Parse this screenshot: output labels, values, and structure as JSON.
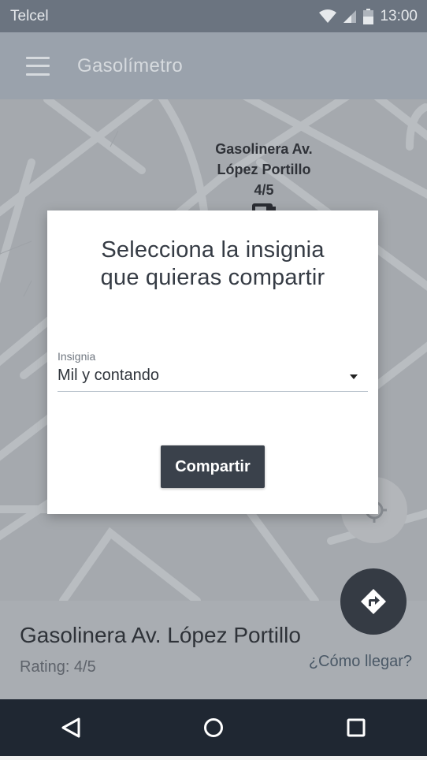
{
  "status_bar": {
    "carrier": "Telcel",
    "time": "13:00",
    "icons": [
      "wifi-icon",
      "signal-icon",
      "battery-icon"
    ]
  },
  "app_bar": {
    "title": "Gasolímetro",
    "menu_icon": "hamburger-menu-icon"
  },
  "map": {
    "marker_label_lines": [
      "Gasolinera Av.",
      "López Portillo",
      "4/5"
    ],
    "marker_icon": "gas-pump-icon",
    "locate_icon": "crosshair-icon"
  },
  "dialog": {
    "title_lines": [
      "Selecciona la insignia",
      "que quieras compartir"
    ],
    "field_label": "Insignia",
    "selected_value": "Mil y contando",
    "share_label": "Compartir"
  },
  "station": {
    "name": "Gasolinera Av. López Portillo",
    "rating": "Rating: 4/5",
    "directions_label": "¿Cómo llegar?",
    "directions_icon": "directions-icon"
  },
  "nav_bar": {
    "icons": [
      "back-icon",
      "home-icon",
      "recents-icon"
    ]
  },
  "colors": {
    "status_bar": "#6b7480",
    "app_bar": "#9aa2ac",
    "map": "#a5a9ae",
    "dialog_button": "#3a414b",
    "fab": "#353b44",
    "nav_bar": "#1f2732"
  }
}
